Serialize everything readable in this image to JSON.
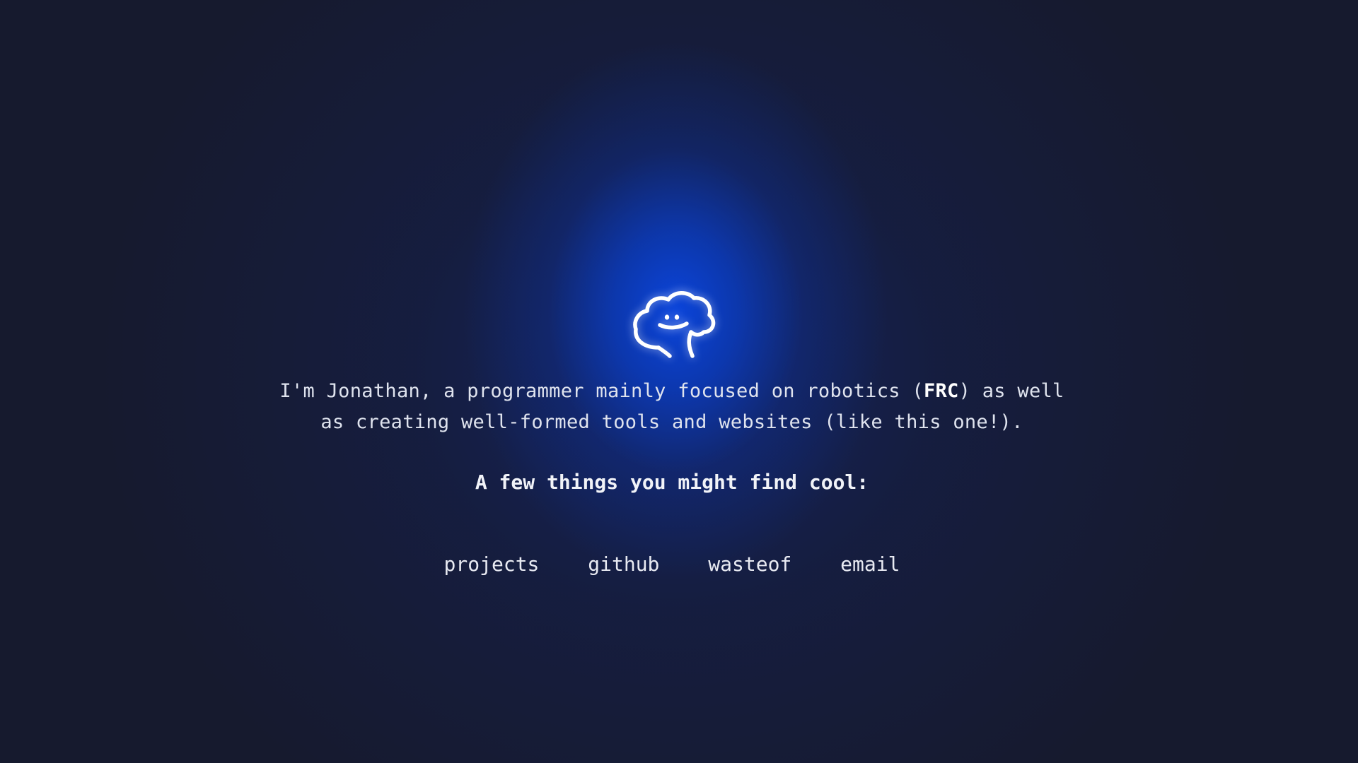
{
  "intro": {
    "line1_before": "I'm Jonathan, a programmer mainly focused on robotics (",
    "line1_bold": "FRC",
    "line1_after": ") as well",
    "line2": "as creating well-formed tools and websites (like this one!)."
  },
  "heading": "A few things you might find cool:",
  "links": [
    {
      "label": "projects"
    },
    {
      "label": "github"
    },
    {
      "label": "wasteof"
    },
    {
      "label": "email"
    }
  ],
  "mascot": {
    "icon": "brain-cloud-face-icon"
  },
  "colors": {
    "background": "#161a2e",
    "glow": "#0a46e1",
    "text": "#dfe3ee"
  }
}
